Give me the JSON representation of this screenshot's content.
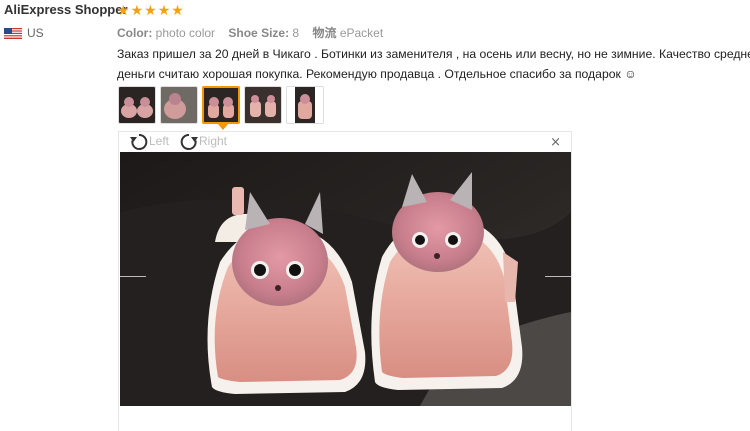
{
  "review": {
    "user_name": "AliExpress Shopper",
    "country": "US",
    "flag_icon": "us-flag-icon",
    "rating": 5,
    "star_color": "#f2a20c",
    "attributes": [
      {
        "label": "Color:",
        "value": "photo color"
      },
      {
        "label": "Shoe Size:",
        "value": "8"
      },
      {
        "label": "物流",
        "value": "ePacket"
      }
    ],
    "text_line1": "Заказ пришел за 20 дней в Чикаго . Ботинки из заменителя , на осень или весну, но не зимние. Качество средне",
    "text_line2": "деньги считаю хорошая покупка. Рекомендую продавца . Отдельное спасибо за подарок ☺"
  },
  "gallery": {
    "thumbnail_count": 5,
    "active_index": 2,
    "active_color": "#f39800"
  },
  "viewer": {
    "rotate_left_label": "Left",
    "rotate_right_label": "Right",
    "close_symbol": "×"
  }
}
